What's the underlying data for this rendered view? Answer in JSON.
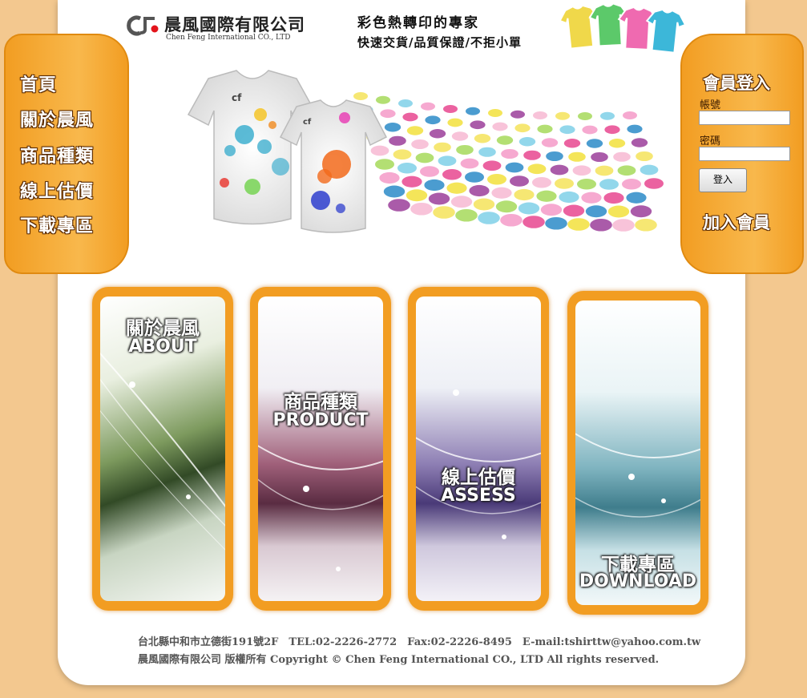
{
  "header": {
    "company_name": "晨風國際有限公司",
    "company_en": "Chen Feng International CO., LTD",
    "tagline1": "彩色熱轉印的專家",
    "tagline2": "快速交貨/品質保證/不拒小單"
  },
  "nav": {
    "items": [
      "首頁",
      "關於晨風",
      "商品種類",
      "線上估價",
      "下載專區"
    ]
  },
  "login": {
    "title": "會員登入",
    "account_label": "帳號",
    "password_label": "密碼",
    "login_button": "登入",
    "join_link": "加入會員"
  },
  "panels": [
    {
      "zh": "關於晨風",
      "en": "ABOUT"
    },
    {
      "zh": "商品種類",
      "en": "PRODUCT"
    },
    {
      "zh": "線上估價",
      "en": "ASSESS"
    },
    {
      "zh": "下載專區",
      "en": "DOWNLOAD"
    }
  ],
  "footer": {
    "line1": "台北縣中和市立德街191號2F　TEL:02-2226-2772　Fax:02-2226-8495　E-mail:tshirttw@yahoo.com.tw",
    "line2": "晨風國際有限公司 版權所有 Copyright © Chen Feng International CO., LTD All rights reserved."
  },
  "colors": {
    "background": "#f3c88f",
    "accent": "#f29d22"
  }
}
